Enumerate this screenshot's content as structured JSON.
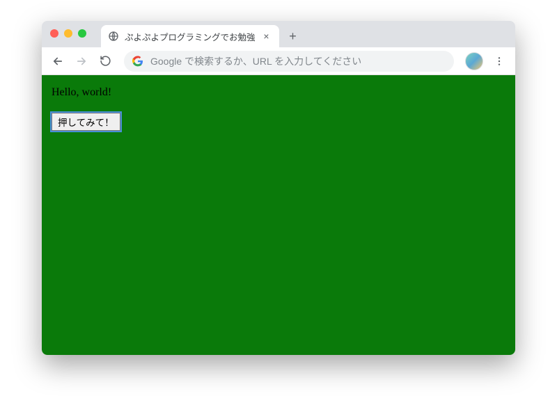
{
  "browser": {
    "tab": {
      "title": "ぷよぷよプログラミングでお勉強"
    },
    "omnibox": {
      "placeholder": "Google で検索するか、URL を入力してください"
    }
  },
  "page": {
    "greeting": "Hello, world!",
    "button_label": "押してみて！"
  },
  "colors": {
    "page_bg": "#0a7a0a"
  }
}
